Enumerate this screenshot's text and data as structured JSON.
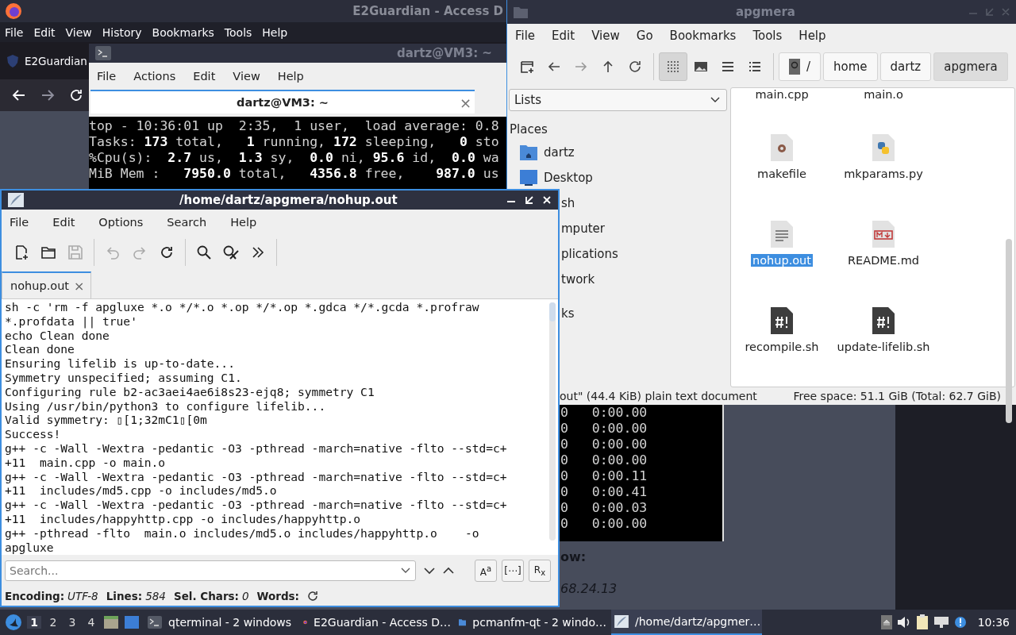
{
  "firefox": {
    "title": "E2Guardian - Access D",
    "menu": [
      "File",
      "Edit",
      "View",
      "History",
      "Bookmarks",
      "Tools",
      "Help"
    ],
    "tab": {
      "label": "E2Guardian"
    },
    "page": [
      {
        "text": "ow:",
        "kind": "bold"
      },
      {
        "text": "68.24.13",
        "kind": "italic"
      }
    ]
  },
  "terminal": {
    "title": "dartz@VM3: ~",
    "menu": [
      "File",
      "Actions",
      "Edit",
      "View",
      "Help"
    ],
    "tab": {
      "label": "dartz@VM3: ~",
      "close": "×"
    },
    "top_lines": [
      "top - 10:36:01 up  2:35,  1 user,  load average: 0.8",
      "Tasks: **173** total,   **1** running, **172** sleeping,   **0** sto",
      "%Cpu(s):  **2.7** us,  **1.3** sy,  **0.0** ni, **95.6** id,  **0.0** wa",
      "MiB Mem :   **7950.0** total,   **4356.8** free,    **987.0** us"
    ],
    "process_rows": [
      "0   0:00.00",
      "0   0:00.00",
      "0   0:00.00",
      "0   0:00.00",
      "0   0:00.11",
      "0   0:00.41",
      "0   0:00.03",
      "0   0:00.00"
    ]
  },
  "file_manager": {
    "title": "apgmera",
    "menu": [
      "File",
      "Edit",
      "View",
      "Go",
      "Bookmarks",
      "Tools",
      "Help"
    ],
    "toolbar": [
      {
        "kind": "new-tab"
      },
      {
        "kind": "back"
      },
      {
        "kind": "forward"
      },
      {
        "kind": "up"
      },
      {
        "kind": "reload"
      }
    ],
    "views": [
      {
        "kind": "icons",
        "selected": true
      },
      {
        "kind": "thumbnails",
        "selected": false
      },
      {
        "kind": "compact",
        "selected": false
      },
      {
        "kind": "details",
        "selected": false
      }
    ],
    "path": [
      {
        "label": "/",
        "kind": "root",
        "selected": false
      },
      {
        "label": "home",
        "kind": "dir",
        "selected": false
      },
      {
        "label": "dartz",
        "kind": "dir",
        "selected": false
      },
      {
        "label": "apgmera",
        "kind": "dir",
        "selected": true
      }
    ],
    "side_dropdown": "Lists",
    "places_heading": "Places",
    "places": [
      {
        "label": "dartz",
        "kind": "home"
      },
      {
        "label": "Desktop",
        "kind": "desktop"
      },
      {
        "label": "sh",
        "kind": "cut"
      },
      {
        "label": "mputer",
        "kind": "cut"
      },
      {
        "label": "plications",
        "kind": "cut"
      },
      {
        "label": "twork",
        "kind": "cut"
      }
    ],
    "bookmarks_heading": "ks",
    "files": [
      {
        "name": "main.cpp",
        "kind": "cut",
        "selected": false
      },
      {
        "name": "main.o",
        "kind": "cut",
        "selected": false
      },
      {
        "name": "makefile",
        "kind": "gear",
        "selected": false
      },
      {
        "name": "mkparams.py",
        "kind": "python",
        "selected": false
      },
      {
        "name": "nohup.out",
        "kind": "text",
        "selected": true
      },
      {
        "name": "README.md",
        "kind": "markdown",
        "selected": false
      },
      {
        "name": "recompile.sh",
        "kind": "script",
        "selected": false
      },
      {
        "name": "update-lifelib.sh",
        "kind": "script",
        "selected": false
      }
    ],
    "status": {
      "left": "out\" (44.4 KiB) plain text document",
      "right": "Free space: 51.1 GiB (Total: 62.7 GiB)"
    }
  },
  "editor": {
    "title": "/home/dartz/apgmera/nohup.out",
    "menu": [
      "File",
      "Edit",
      "Options",
      "Search",
      "Help"
    ],
    "toolbar": [
      {
        "kind": "new",
        "disabled": false
      },
      {
        "kind": "open",
        "disabled": false
      },
      {
        "kind": "save",
        "disabled": true
      },
      {
        "kind": "sep"
      },
      {
        "kind": "undo",
        "disabled": true
      },
      {
        "kind": "redo",
        "disabled": true
      },
      {
        "kind": "reload",
        "disabled": false
      },
      {
        "kind": "sep"
      },
      {
        "kind": "find",
        "disabled": false
      },
      {
        "kind": "clear",
        "disabled": false
      },
      {
        "kind": "more",
        "disabled": false
      },
      {
        "kind": "sep"
      }
    ],
    "tab": {
      "label": "nohup.out",
      "close": "×"
    },
    "lines": [
      "sh -c 'rm -f apgluxe *.o */*.o *.op */*.op *.gdca */*.gcda *.profraw",
      "*.profdata || true'",
      "echo Clean done",
      "Clean done",
      "Ensuring lifelib is up-to-date...",
      "Symmetry unspecified; assuming C1.",
      "Configuring rule b2-ac3aei4ae6i8s23-ejq8; symmetry C1",
      "Using /usr/bin/python3 to configure lifelib...",
      "Valid symmetry: ▯[1;32mC1▯[0m",
      "Success!",
      "g++ -c -Wall -Wextra -pedantic -O3 -pthread -march=native -flto --std=c+",
      "+11  main.cpp -o main.o",
      "g++ -c -Wall -Wextra -pedantic -O3 -pthread -march=native -flto --std=c+",
      "+11  includes/md5.cpp -o includes/md5.o",
      "g++ -c -Wall -Wextra -pedantic -O3 -pthread -march=native -flto --std=c+",
      "+11  includes/happyhttp.cpp -o includes/happyhttp.o",
      "g++ -pthread -flto  main.o includes/md5.o includes/happyhttp.o    -o",
      "apgluxe"
    ],
    "search": {
      "placeholder": "Search...",
      "options": [
        "A$^{a}$",
        "[⋯]",
        "R$_{x}$"
      ]
    },
    "status": [
      {
        "label": "Encoding:",
        "value": "UTF-8"
      },
      {
        "label": "Lines:",
        "value": "584"
      },
      {
        "label": "Sel. Chars:",
        "value": "0"
      },
      {
        "label": "Words:"
      }
    ]
  },
  "taskbar": {
    "desktops": [
      {
        "label": "1",
        "selected": true
      },
      {
        "label": "2",
        "selected": false
      },
      {
        "label": "3",
        "selected": false
      },
      {
        "label": "4",
        "selected": false
      }
    ],
    "tasks": [
      {
        "label": "qterminal - 2 windows",
        "kind": "terminal",
        "selected": false
      },
      {
        "label": "E2Guardian - Access D…",
        "kind": "firefox",
        "selected": false
      },
      {
        "label": "pcmanfm-qt - 2 windo…",
        "kind": "folder",
        "selected": false
      },
      {
        "label": "/home/dartz/apgmer…",
        "kind": "editor",
        "selected": true
      }
    ],
    "clock": "10:36"
  }
}
